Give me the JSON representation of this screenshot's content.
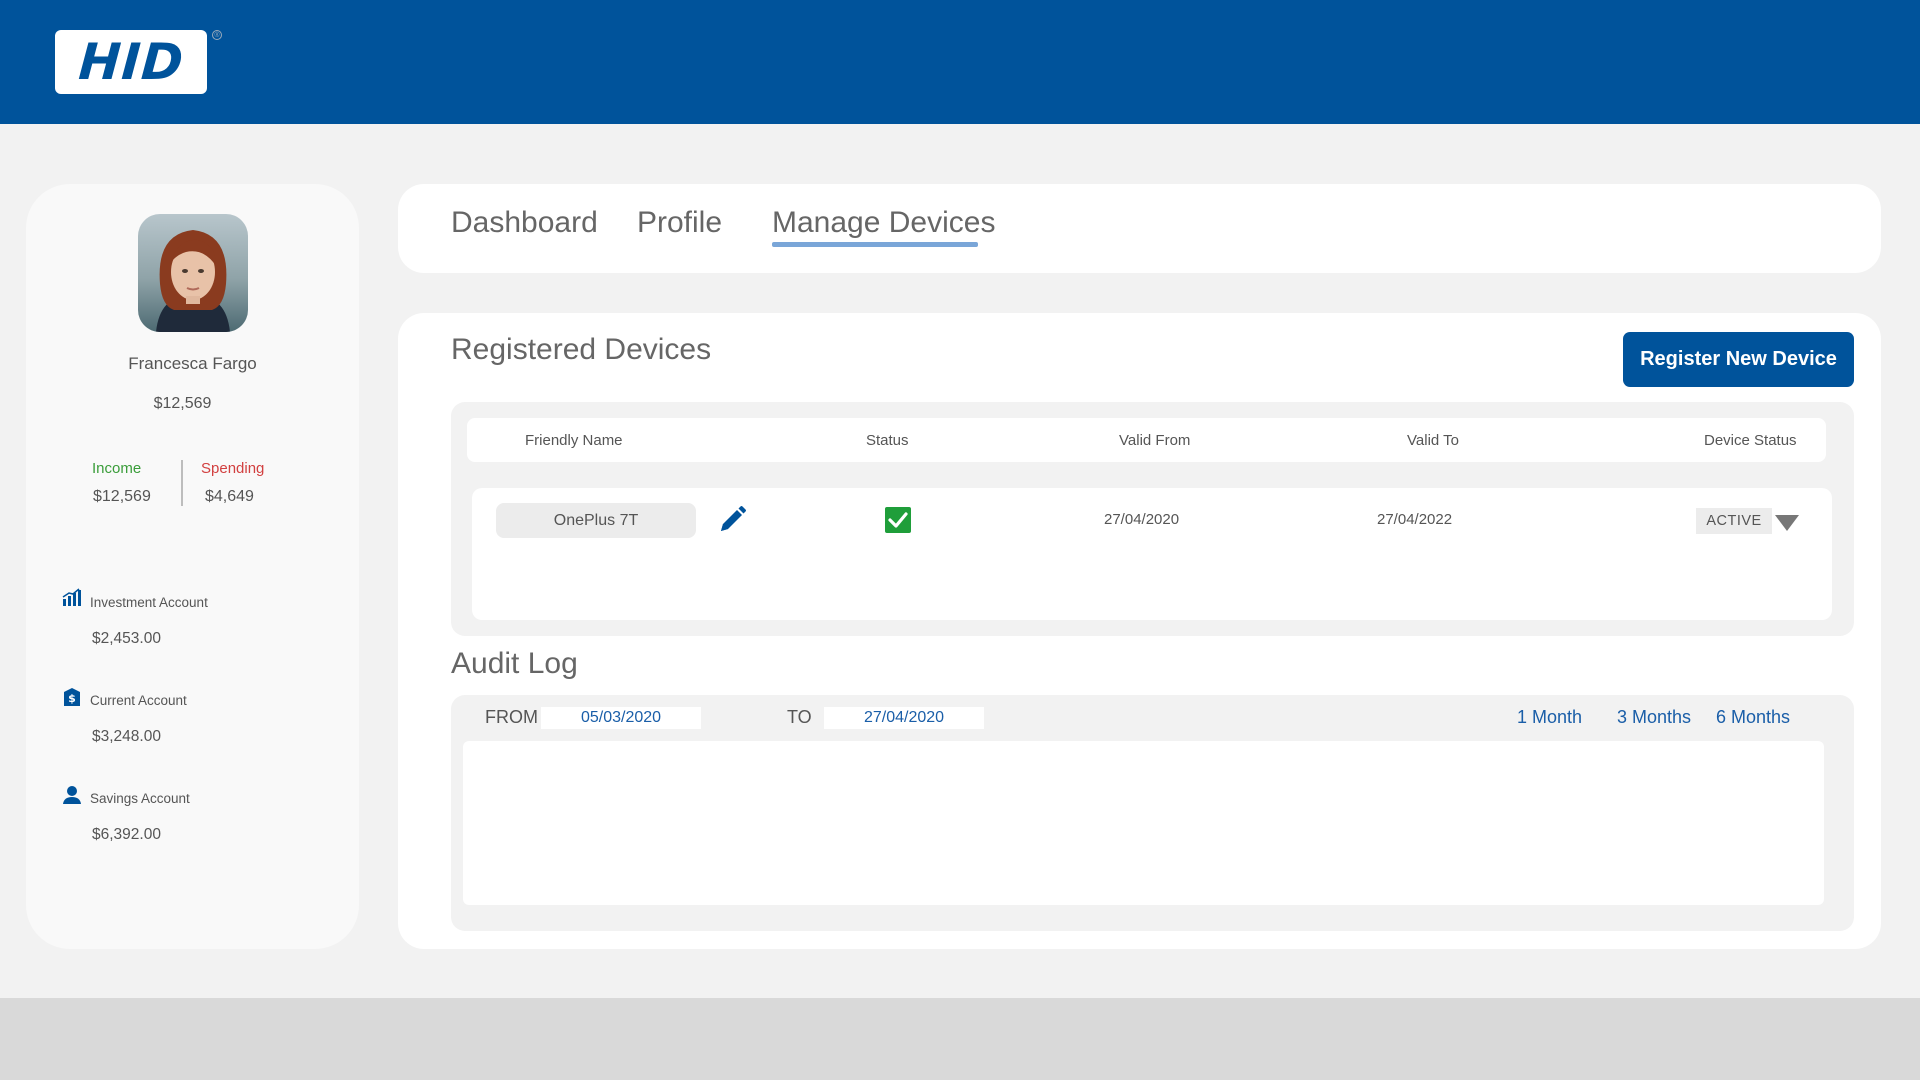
{
  "brand": {
    "logo_text": "HID",
    "registered_mark": "®"
  },
  "user": {
    "name": "Francesca Fargo",
    "balance": "$12,569",
    "income_label": "Income",
    "income_value": "$12,569",
    "spending_label": "Spending",
    "spending_value": "$4,649"
  },
  "accounts": [
    {
      "label": "Investment Account",
      "value": "$2,453.00",
      "icon": "bar-chart-icon"
    },
    {
      "label": "Current Account",
      "value": "$3,248.00",
      "icon": "dollar-shield-icon"
    },
    {
      "label": "Savings Account",
      "value": "$6,392.00",
      "icon": "person-icon"
    }
  ],
  "tabs": [
    {
      "label": "Dashboard",
      "active": false
    },
    {
      "label": "Profile",
      "active": false
    },
    {
      "label": "Manage Devices",
      "active": true
    }
  ],
  "devices": {
    "title": "Registered Devices",
    "register_button": "Register New Device",
    "columns": [
      "Friendly Name",
      "Status",
      "Valid From",
      "Valid To",
      "Device Status"
    ],
    "rows": [
      {
        "friendly_name": "OnePlus 7T",
        "status_icon": "checked-checkbox-icon",
        "valid_from": "27/04/2020",
        "valid_to": "27/04/2022",
        "device_status": "ACTIVE"
      }
    ]
  },
  "audit": {
    "title": "Audit Log",
    "from_label": "FROM",
    "from_value": "05/03/2020",
    "to_label": "TO",
    "to_value": "27/04/2020",
    "quick_ranges": [
      "1 Month",
      "3 Months",
      "6 Months"
    ]
  },
  "colors": {
    "brand_blue": "#00539b",
    "income_green": "#3a9d3a",
    "spending_red": "#d24040",
    "check_green": "#1f9e3a",
    "link_blue": "#1a5ea8"
  }
}
